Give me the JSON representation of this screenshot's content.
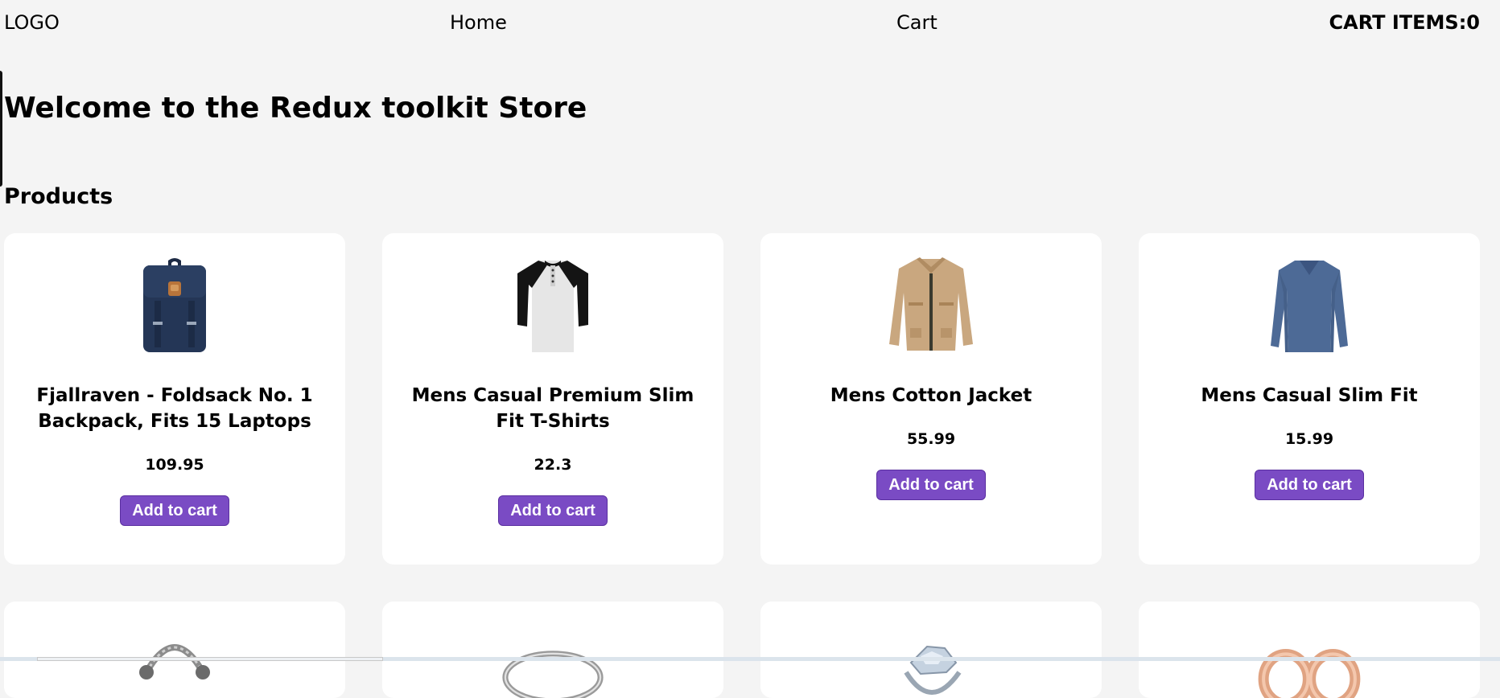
{
  "nav": {
    "logo": "LOGO",
    "home": "Home",
    "cart": "Cart",
    "cart_items": "CART ITEMS:0"
  },
  "page": {
    "title": "Welcome to the Redux toolkit Store",
    "products_heading": "Products"
  },
  "products": [
    {
      "title": "Fjallraven - Foldsack No. 1 Backpack, Fits 15 Laptops",
      "price": "109.95",
      "button": "Add to cart",
      "icon": "backpack-image"
    },
    {
      "title": "Mens Casual Premium Slim Fit T-Shirts",
      "price": "22.3",
      "button": "Add to cart",
      "icon": "raglan-tshirt-image"
    },
    {
      "title": "Mens Cotton Jacket",
      "price": "55.99",
      "button": "Add to cart",
      "icon": "cotton-jacket-image"
    },
    {
      "title": "Mens Casual Slim Fit",
      "price": "15.99",
      "button": "Add to cart",
      "icon": "slim-fit-shirt-image"
    }
  ],
  "partial_products": [
    {
      "icon": "bracelet-image"
    },
    {
      "icon": "silver-ring-image"
    },
    {
      "icon": "diamond-ring-image"
    },
    {
      "icon": "rose-gold-earrings-image"
    }
  ],
  "colors": {
    "background": "#f4f4f4",
    "card": "#ffffff",
    "button": "#7a4bc4",
    "button_text": "#ffffff"
  }
}
